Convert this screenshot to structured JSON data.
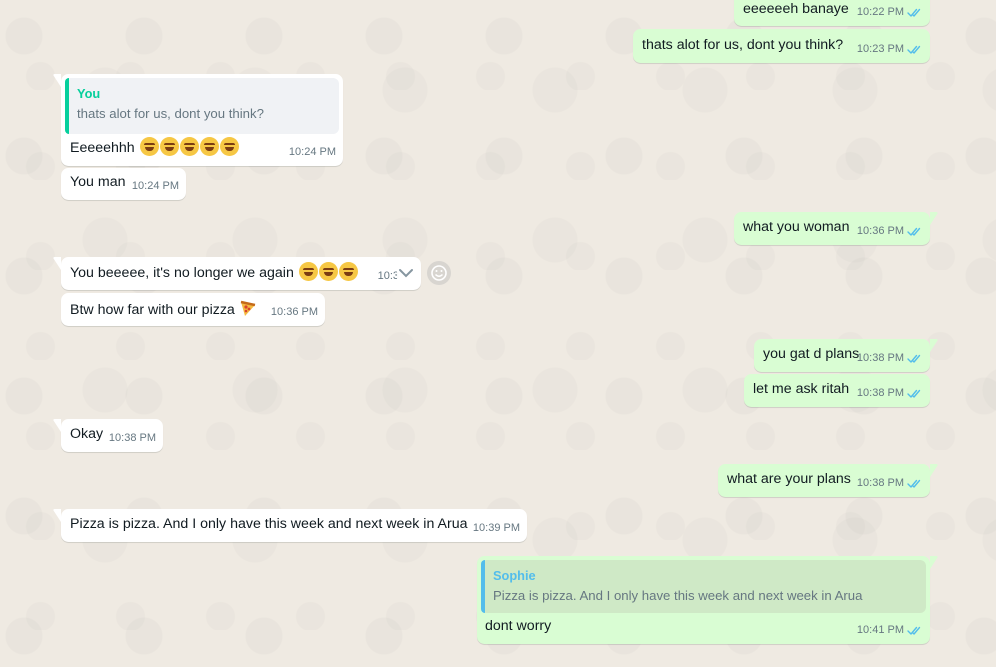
{
  "colors": {
    "bg": "#efeae2",
    "incoming": "#ffffff",
    "outgoing": "#d9fdd3",
    "read_ticks": "#53bdeb",
    "quote_you": "#06cf9c",
    "quote_sophie": "#53bdeb"
  },
  "messages": [
    {
      "text": "eeeeeeh banaye",
      "time": "10:22 PM"
    },
    {
      "text": "thats alot for us, dont you think?",
      "time": "10:23 PM"
    },
    {
      "quote_author": "You",
      "quote_text": "thats alot for us, dont you think?",
      "text": "Eeeeehhh",
      "time": "10:24 PM"
    },
    {
      "text": "You man",
      "time": "10:24 PM"
    },
    {
      "text": "what you woman",
      "time": "10:36 PM"
    },
    {
      "text": "You beeeee, it's no longer we again",
      "time": "10:3"
    },
    {
      "text": "Btw how far with our pizza",
      "time": "10:36 PM"
    },
    {
      "text": "you gat d plans",
      "time": "10:38 PM"
    },
    {
      "text": "let me ask ritah",
      "time": "10:38 PM"
    },
    {
      "text": "Okay",
      "time": "10:38 PM"
    },
    {
      "text": "what are your plans",
      "time": "10:38 PM"
    },
    {
      "text": "Pizza is pizza. And I only have this week and next week in Arua",
      "time": "10:39 PM"
    },
    {
      "quote_author": "Sophie",
      "quote_text": "Pizza is pizza. And I only have this week and next week in Arua",
      "text": "dont worry",
      "time": "10:41 PM"
    }
  ],
  "icons": {
    "read": "double-check-icon",
    "emoji_laugh": "tears-of-joy-emoji",
    "pizza": "pizza-emoji",
    "menu": "chevron-down-icon",
    "react": "smiley-icon"
  }
}
